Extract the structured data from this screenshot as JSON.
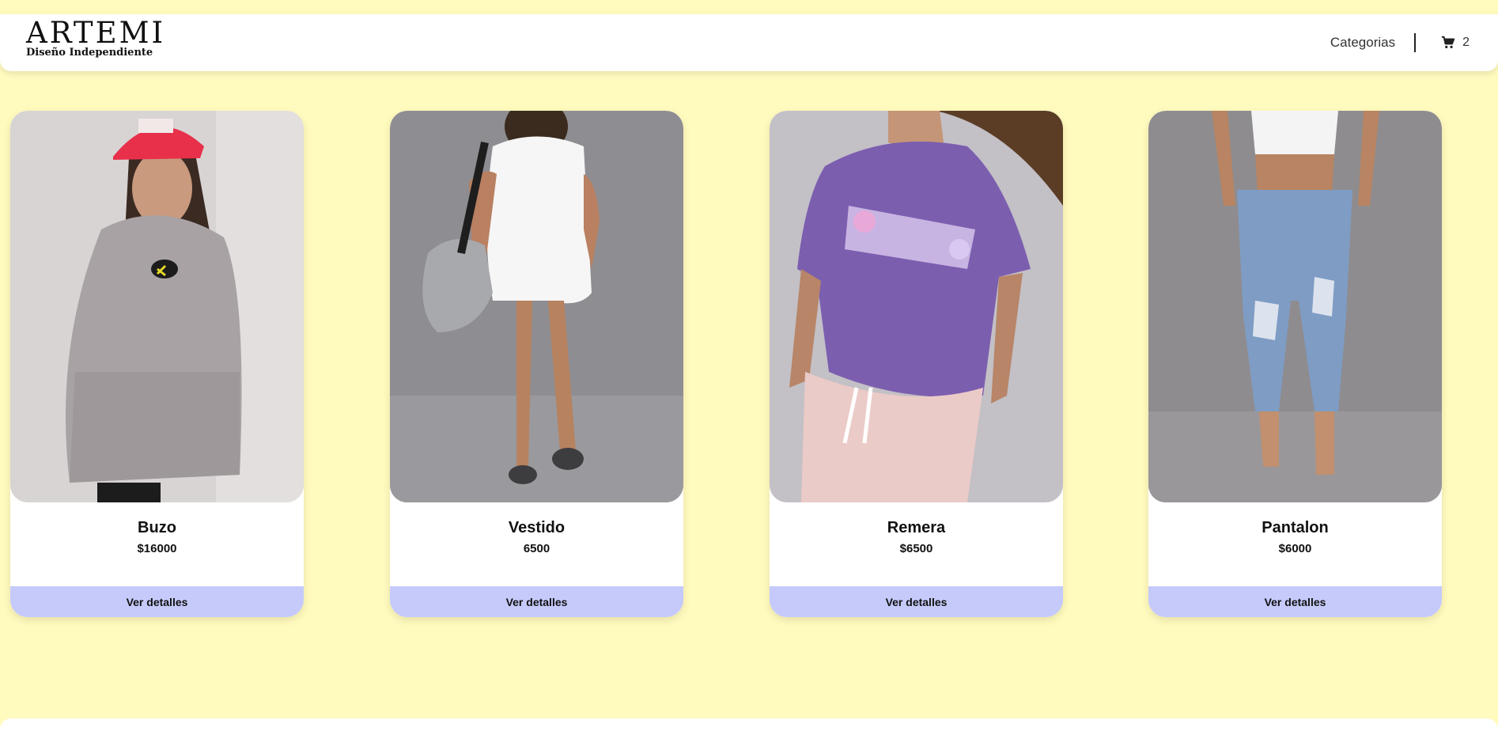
{
  "brand": {
    "name": "ARTEMI",
    "tagline": "Diseño Independiente"
  },
  "nav": {
    "categories_label": "Categorias",
    "cart_icon": "shopping-cart-icon",
    "cart_count": "2"
  },
  "products": [
    {
      "title": "Buzo",
      "price": "$16000",
      "button_label": "Ver detalles",
      "image": "woman in grey hoodie and red cap"
    },
    {
      "title": "Vestido",
      "price": "6500",
      "button_label": "Ver detalles",
      "image": "woman in white dress with grey bag"
    },
    {
      "title": "Remera",
      "price": "$6500",
      "button_label": "Ver detalles",
      "image": "woman in purple t-shirt"
    },
    {
      "title": "Pantalon",
      "price": "$6000",
      "button_label": "Ver detalles",
      "image": "woman in ripped jeans"
    }
  ],
  "colors": {
    "page_background": "#FFFABD",
    "button_background": "#C5CAFB",
    "card_background": "#FFFFFF"
  }
}
